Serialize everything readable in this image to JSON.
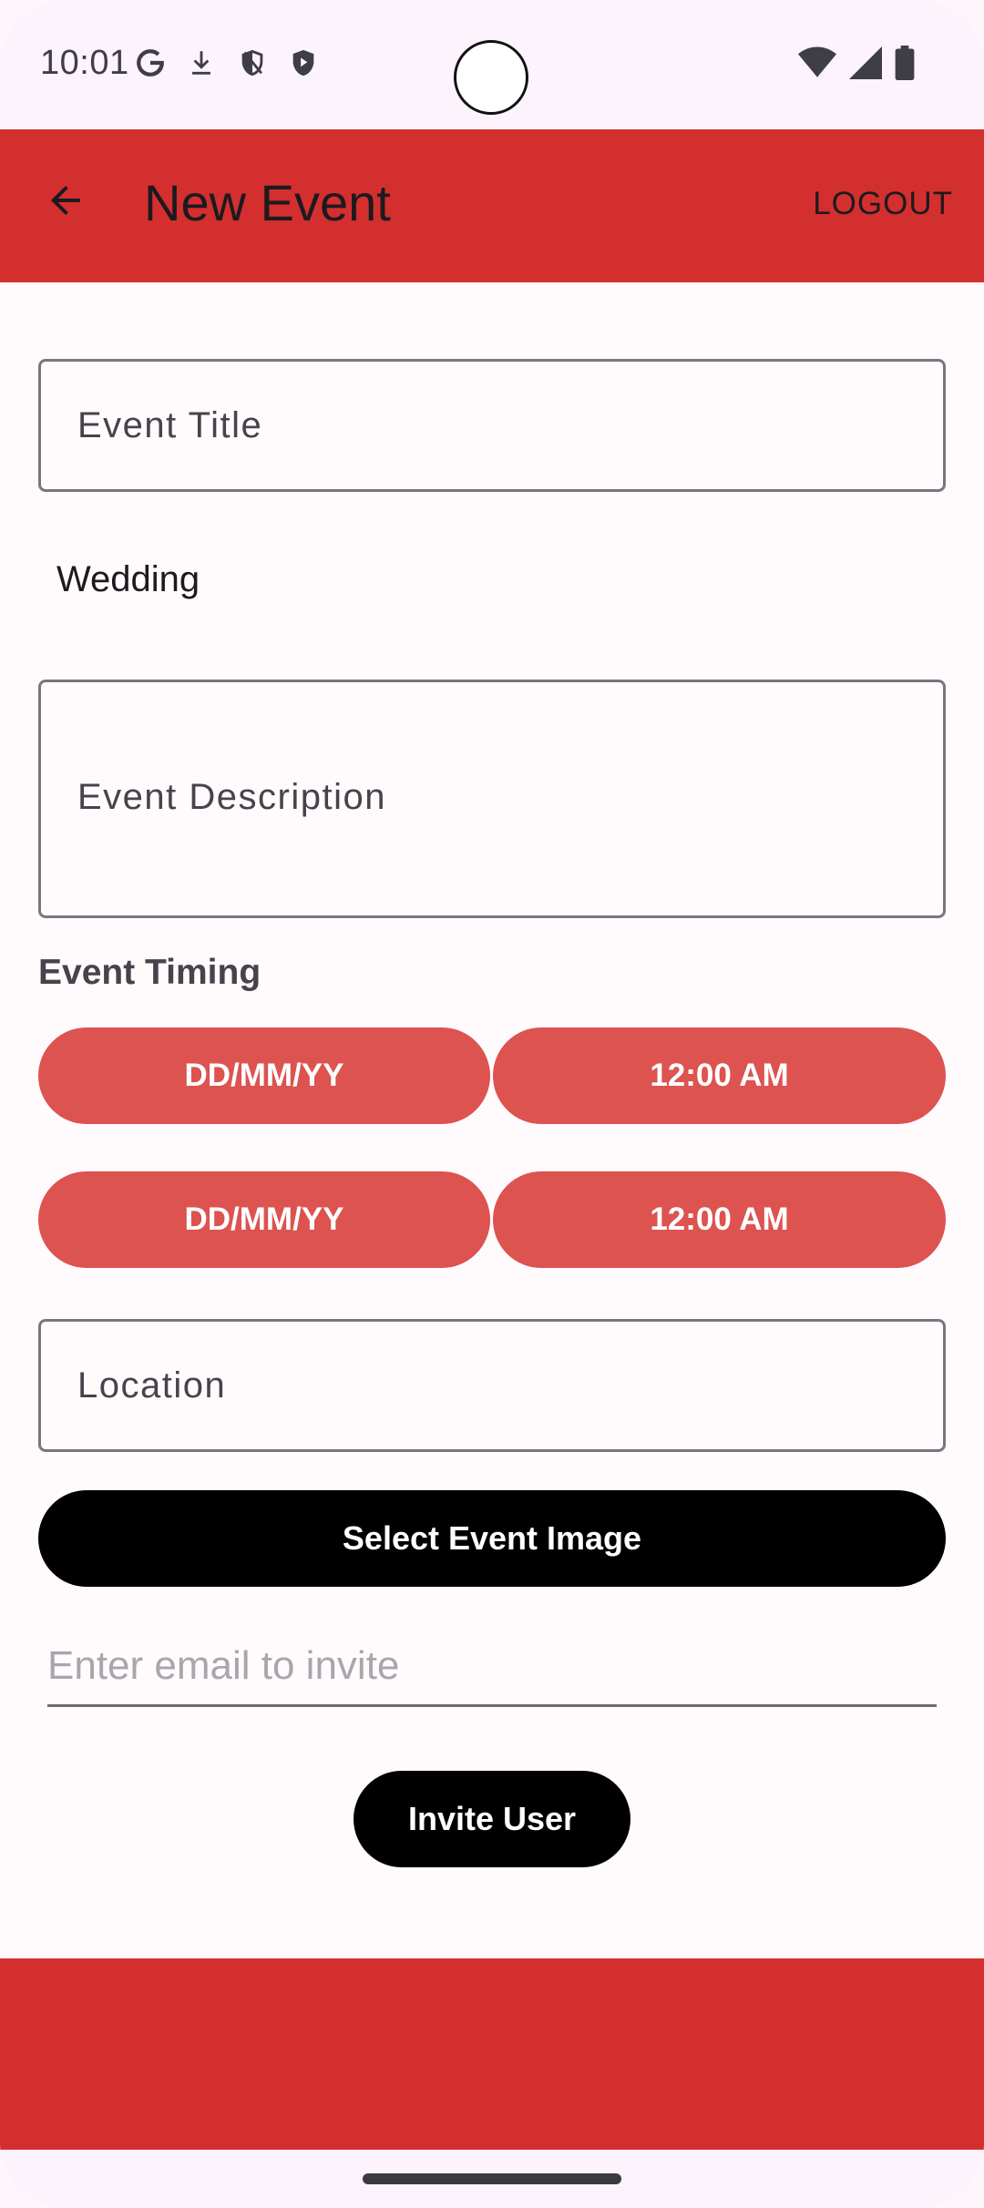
{
  "status_bar": {
    "time": "10:01",
    "left_icons": [
      "google-icon",
      "download-icon",
      "shield-outline-icon",
      "shield-play-icon"
    ],
    "right_icons": [
      "wifi-icon",
      "signal-icon",
      "battery-icon"
    ]
  },
  "app_bar": {
    "title": "New Event",
    "logout_label": "LOGOUT",
    "color": "#d32f2f"
  },
  "form": {
    "event_title_label": "Event Title",
    "event_type_value": "Wedding",
    "event_description_label": "Event Description",
    "timing_heading": "Event Timing",
    "start_date": "DD/MM/YY",
    "start_time": "12:00 AM",
    "end_date": "DD/MM/YY",
    "end_time": "12:00 AM",
    "location_label": "Location",
    "select_image_label": "Select Event Image",
    "invite_email_placeholder": "Enter email to invite",
    "invite_button_label": "Invite User",
    "pill_color": "#dc5350"
  }
}
